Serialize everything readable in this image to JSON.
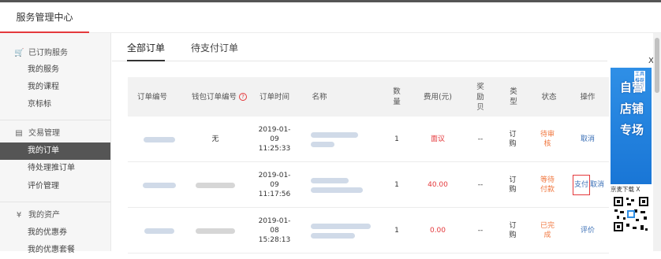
{
  "header": {
    "title": "服务管理中心"
  },
  "sidebar": {
    "groups": [
      {
        "title": "已订购服务",
        "icon": "cart-icon",
        "items": [
          {
            "label": "我的服务"
          },
          {
            "label": "我的课程"
          },
          {
            "label": "京标标"
          }
        ]
      },
      {
        "title": "交易管理",
        "icon": "document-icon",
        "items": [
          {
            "label": "我的订单",
            "active": true
          },
          {
            "label": "待处理推订单"
          },
          {
            "label": "评价管理"
          }
        ]
      },
      {
        "title": "我的资产",
        "icon": "yen-icon",
        "items": [
          {
            "label": "我的优惠券"
          },
          {
            "label": "我的优惠套餐"
          }
        ]
      }
    ]
  },
  "tabs": [
    {
      "label": "全部订单",
      "active": true
    },
    {
      "label": "待支付订单"
    }
  ],
  "table": {
    "headers": {
      "order_no": "订单编号",
      "wallet_no": "钱包订单编号",
      "time": "订单时间",
      "name": "名称",
      "qty": "数量",
      "cost": "费用(元)",
      "bonus": "奖励贝",
      "type": "类型",
      "status": "状态",
      "action": "操作"
    },
    "rows": [
      {
        "wallet": "无",
        "date": "2019-01-09",
        "time": "11:25:33",
        "qty": "1",
        "cost": "面议",
        "bonus": "--",
        "type": "订购",
        "status": "待审核",
        "actions": [
          "取消"
        ]
      },
      {
        "wallet": "",
        "date": "2019-01-09",
        "time": "11:17:56",
        "qty": "1",
        "cost": "40.00",
        "bonus": "--",
        "type": "订购",
        "status": "等待付款",
        "actions": [
          "支付",
          "取消"
        ]
      },
      {
        "wallet": "",
        "date": "2019-01-08",
        "time": "15:28:13",
        "qty": "1",
        "cost": "0.00",
        "bonus": "--",
        "type": "订购",
        "status": "已完成",
        "actions": [
          "评价"
        ]
      }
    ]
  },
  "ad": {
    "tag": "工具推荐",
    "text": "自营店铺专场",
    "download": "京麦下载",
    "close": "X"
  },
  "colors": {
    "accent": "#e4393c",
    "link": "#3a6fb6",
    "status": "#f07840",
    "ad_blue": "#1976d6"
  }
}
